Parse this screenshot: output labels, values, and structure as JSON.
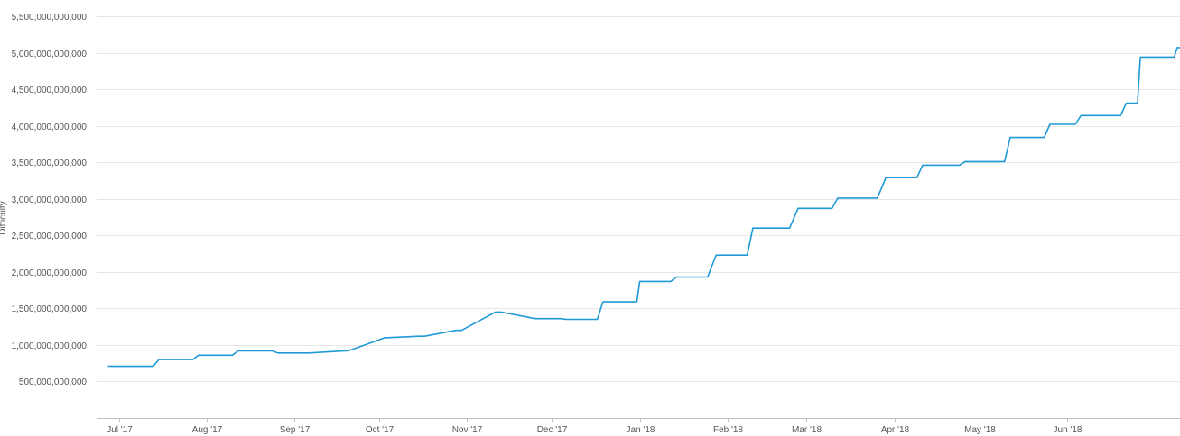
{
  "chart_data": {
    "type": "line",
    "title": "",
    "xlabel": "",
    "ylabel": "Difficulty",
    "ylim": [
      0,
      5500000000000
    ],
    "yticks": [
      500000000000,
      1000000000000,
      1500000000000,
      2000000000000,
      2500000000000,
      3000000000000,
      3500000000000,
      4000000000000,
      4500000000000,
      5000000000000,
      5500000000000
    ],
    "ytick_labels": [
      "500,000,000,000",
      "1,000,000,000,000",
      "1,500,000,000,000",
      "2,000,000,000,000",
      "2,500,000,000,000",
      "3,000,000,000,000",
      "3,500,000,000,000",
      "4,000,000,000,000",
      "4,500,000,000,000",
      "5,000,000,000,000",
      "5,500,000,000,000"
    ],
    "xlim": [
      "2017-06-23",
      "2018-07-11"
    ],
    "xticks": [
      "2017-07-01",
      "2017-08-01",
      "2017-09-01",
      "2017-10-01",
      "2017-11-01",
      "2017-12-01",
      "2018-01-01",
      "2018-02-01",
      "2018-03-01",
      "2018-04-01",
      "2018-05-01",
      "2018-06-01"
    ],
    "xtick_labels": [
      "Jul '17",
      "Aug '17",
      "Sep '17",
      "Oct '17",
      "Nov '17",
      "Dec '17",
      "Jan '18",
      "Feb '18",
      "Mar '18",
      "Apr '18",
      "May '18",
      "Jun '18"
    ],
    "grid": true,
    "color": "#1f9ad6",
    "series": [
      {
        "x": [
          "2017-06-27",
          "2017-07-01",
          "2017-07-13",
          "2017-07-15",
          "2017-07-27",
          "2017-07-29",
          "2017-08-10",
          "2017-08-12",
          "2017-08-24",
          "2017-08-26",
          "2017-09-06",
          "2017-09-19",
          "2017-09-20",
          "2017-10-03",
          "2017-10-04",
          "2017-10-15",
          "2017-10-17",
          "2017-10-28",
          "2017-10-30",
          "2017-11-11",
          "2017-11-13",
          "2017-11-25",
          "2017-12-04",
          "2017-12-06",
          "2017-12-17",
          "2017-12-19",
          "2017-12-31",
          "2018-01-01",
          "2018-01-12",
          "2018-01-14",
          "2018-01-25",
          "2018-01-28",
          "2018-02-08",
          "2018-02-10",
          "2018-02-23",
          "2018-02-26",
          "2018-03-10",
          "2018-03-12",
          "2018-03-26",
          "2018-03-29",
          "2018-04-09",
          "2018-04-11",
          "2018-04-24",
          "2018-04-26",
          "2018-05-10",
          "2018-05-12",
          "2018-05-24",
          "2018-05-26",
          "2018-06-04",
          "2018-06-06",
          "2018-06-20",
          "2018-06-22",
          "2018-06-26"
        ],
        "y": [
          710000000000,
          708000000000,
          708000000000,
          800000000000,
          800000000000,
          860000000000,
          860000000000,
          920000000000,
          920000000000,
          890000000000,
          890000000000,
          920000000000,
          920000000000,
          1100000000000,
          1100000000000,
          1120000000000,
          1120000000000,
          1200000000000,
          1200000000000,
          1450000000000,
          1450000000000,
          1360000000000,
          1360000000000,
          1350000000000,
          1350000000000,
          1590000000000,
          1590000000000,
          1870000000000,
          1870000000000,
          1930000000000,
          1930000000000,
          2230000000000,
          2230000000000,
          2600000000000,
          2600000000000,
          2870000000000,
          2870000000000,
          3010000000000,
          3010000000000,
          3290000000000,
          3290000000000,
          3460000000000,
          3460000000000,
          3510000000000,
          3510000000000,
          3840000000000,
          3840000000000,
          4020000000000,
          4020000000000,
          4140000000000,
          4140000000000,
          4310000000000,
          4310000000000
        ]
      }
    ],
    "series_tail": {
      "x": [
        "2018-06-27",
        "2018-07-09",
        "2018-07-10",
        "2018-07-11"
      ],
      "y": [
        4940000000000,
        4940000000000,
        5070000000000,
        5070000000000
      ]
    }
  }
}
